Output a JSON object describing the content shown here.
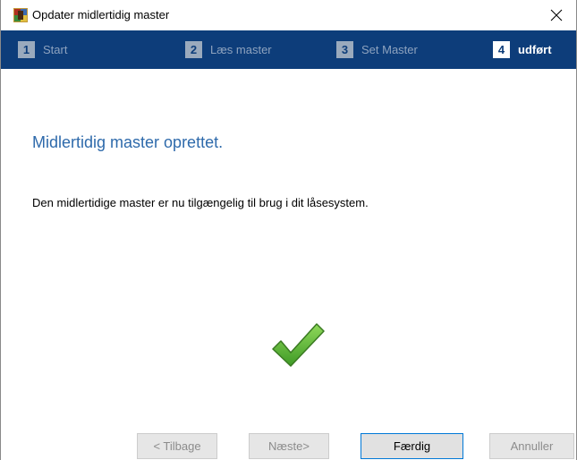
{
  "window": {
    "title": "Opdater midlertidig master",
    "icon": "app-icon",
    "close_icon": "close-icon"
  },
  "steps": [
    {
      "number": "1",
      "label": "Start",
      "active": false
    },
    {
      "number": "2",
      "label": "Læs master",
      "active": false
    },
    {
      "number": "3",
      "label": "Set Master",
      "active": false
    },
    {
      "number": "4",
      "label": "udført",
      "active": true
    }
  ],
  "main": {
    "heading": "Midlertidig master oprettet.",
    "message": "Den midlertidige master er nu tilgængelig til brug i dit låsesystem.",
    "status_icon": "checkmark-icon"
  },
  "buttons": {
    "back_label": "< Tilbage",
    "next_label": "Næste>",
    "finish_label": "Færdig",
    "cancel_label": "Annuller"
  },
  "colors": {
    "header_bar": "#0d3d7a",
    "heading_text": "#2e6aab",
    "checkmark": "#5cb335"
  }
}
